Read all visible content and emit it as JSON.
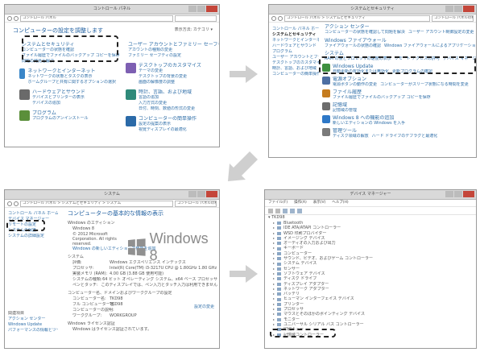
{
  "p1": {
    "title": "コントロール パネル",
    "path": "コントロール パネル",
    "heading": "コンピューターの設定を調整します",
    "viewby": "表示方法: カテゴリ ▾",
    "cats": [
      {
        "title": "システムとセキュリティ",
        "subs": [
          "コンピューターの状態を確認",
          "ファイル履歴でファイルのバックアップ コピーを保存",
          "問題の発見と解決"
        ],
        "color": "#3b6fb6"
      },
      {
        "title": "ネットワークとインターネット",
        "subs": [
          "ネットワークの状態とタスクの表示",
          "ホームグループと共有に関するオプションの選択"
        ],
        "color": "#3a86c8"
      },
      {
        "title": "ハードウェアとサウンド",
        "subs": [
          "デバイスとプリンターの表示",
          "デバイスの追加"
        ],
        "color": "#6a6a6a"
      },
      {
        "title": "プログラム",
        "subs": [
          "プログラムのアンインストール"
        ],
        "color": "#5b8f3a"
      }
    ],
    "cats_r": [
      {
        "title": "ユーザー アカウントとファミリー セーフティ",
        "subs": [
          "アカウントの種類の変更",
          "ファミリー セーフティの設定"
        ],
        "color": "#3f7fbf"
      },
      {
        "title": "デスクトップのカスタマイズ",
        "subs": [
          "テーマの変更",
          "デスクトップの背景の変更",
          "画面の解像度の調整"
        ],
        "color": "#7d5fb2"
      },
      {
        "title": "時計、言語、および地域",
        "subs": [
          "言語の追加",
          "入力方式の変更",
          "日付、時刻、数値の形式の変更"
        ],
        "color": "#2f8a7a"
      },
      {
        "title": "コンピューターの簡単操作",
        "subs": [
          "設定の提案の表示",
          "視覚ディスプレイの最適化"
        ],
        "color": "#2b6aa8"
      }
    ]
  },
  "p2": {
    "title": "システムとセキュリティ",
    "path": "コントロール パネル > システムとセキュリティ",
    "search": "コントロール パネルの検索",
    "nav": [
      "コントロール パネル ホーム",
      "システムとセキュリティ",
      "ネットワークとインターネット",
      "ハードウェアとサウンド",
      "プログラム",
      "ユーザー アカウントとファミリー セーフティ",
      "デスクトップのカスタマイズ",
      "時計、言語、および地域",
      "コンピューターの簡単操作"
    ],
    "sections": [
      {
        "title": "アクション センター",
        "subs": [
          "コンピューターの状態を確認して問題を解決",
          "ユーザー アカウント制御設定の変更"
        ],
        "color": "#c9a227"
      },
      {
        "title": "Windows ファイアウォール",
        "subs": [
          "ファイアウォールの状態の確認",
          "Windows ファイアウォールによるアプリケーションの許可"
        ],
        "color": "#b6502f"
      },
      {
        "title": "システム",
        "subs": [
          "RAM の量とプロセッサの速度の表示",
          "リモート アクセスの許可",
          "デバイス マネージャー"
        ],
        "color": "#4a7fb9"
      },
      {
        "title": "Windows Update",
        "subs": [
          "自動更新の有効化または無効化",
          "更新プログラムの確認"
        ],
        "color": "#3e8f3e"
      },
      {
        "title": "電源オプション",
        "subs": [
          "電源ボタンの動作の変更",
          "コンピューターがスリープ状態になる時間を変更"
        ],
        "color": "#4d6fa3"
      },
      {
        "title": "ファイル履歴",
        "subs": [
          "ファイル履歴でファイルのバックアップ コピーを保存"
        ],
        "color": "#c57c1e"
      },
      {
        "title": "記憶域",
        "subs": [
          "記憶域の管理"
        ],
        "color": "#6d6d6d"
      },
      {
        "title": "Windows 8 への機能の追加",
        "subs": [
          "新しいエディションの Windows を入手"
        ],
        "color": "#2e78c7"
      },
      {
        "title": "管理ツール",
        "subs": [
          "ディスク領域の解放",
          "ハード ドライブのデフラグと最適化"
        ],
        "color": "#7a7a7a"
      }
    ]
  },
  "p3": {
    "title": "システム",
    "path": "コントロール パネル > システムとセキュリティ > システム",
    "search": "コントロール パネルの検索",
    "nav": [
      "コントロール パネル ホーム",
      "デバイス マネージャー",
      "リモートの設定",
      "システムの保護",
      "システムの詳細設定"
    ],
    "heading": "コンピューターの基本的な情報の表示",
    "edition_label": "Windows のエディション",
    "edition": "Windows 8",
    "copyright": "© 2012 Microsoft Corporation. All rights reserved.",
    "more": "Windows の新しいエディションで機能を追加",
    "logo": "Windows 8",
    "system_label": "システム",
    "rows": [
      {
        "k": "評価:",
        "v": "Windows エクスペリエンス インデックス"
      },
      {
        "k": "プロセッサ:",
        "v": "Intel(R) Core(TM) i3-3217U CPU @ 1.80GHz 1.80 GHz"
      },
      {
        "k": "実装メモリ (RAM):",
        "v": "4.00 GB (3.88 GB 使用可能)"
      },
      {
        "k": "システムの種類:",
        "v": "64 ビット オペレーティング システム、x64 ベース プロセッサ"
      },
      {
        "k": "ペンとタッチ:",
        "v": "このディスプレイでは、ペン入力とタッチ入力は利用できません"
      }
    ],
    "cn_label": "コンピューター名、ドメインおよびワークグループの設定",
    "cn_rows": [
      {
        "k": "コンピューター名:",
        "v": "TKD98"
      },
      {
        "k": "フル コンピューター名:",
        "v": "TKD98"
      },
      {
        "k": "コンピューターの説明:",
        "v": ""
      },
      {
        "k": "ワークグループ:",
        "v": "WORKGROUP"
      }
    ],
    "change": "設定の変更",
    "activation_label": "Windows ライセンス認証",
    "activation": "Windows はライセンス認証されています。",
    "see_also": "関連項目",
    "see_items": [
      "アクション センター",
      "Windows Update",
      "パフォーマンスの情報とツール"
    ]
  },
  "p4": {
    "title": "デバイス マネージャー",
    "menu": [
      "ファイル(F)",
      "操作(A)",
      "表示(V)",
      "ヘルプ(H)"
    ],
    "root": "TKD98",
    "items": [
      "Bluetooth",
      "IDE ATA/ATAPI コントローラー",
      "WSD 印刷プロバイダー",
      "イメージング デバイス",
      "オーディオの入力および出力",
      "キーボード",
      "コンピューター",
      "サウンド、ビデオ、およびゲーム コントローラー",
      "システム デバイス",
      "センサー",
      "ソフトウェア デバイス",
      "ディスク ドライブ",
      "ディスプレイ アダプター",
      "ネットワーク アダプター",
      "バッテリ",
      "ヒューマン インターフェイス デバイス",
      "プリンター",
      "プロセッサ",
      "マウスとそのほかのポインティング デバイス",
      "モニター",
      "ユニバーサル シリアル バス コントローラー",
      "印刷キュー",
      "記憶域コントローラー"
    ]
  }
}
